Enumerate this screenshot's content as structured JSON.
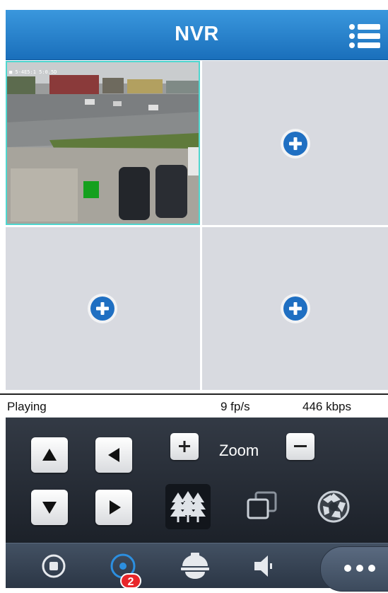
{
  "header": {
    "title": "NVR",
    "menu_icon": "list-menu-icon"
  },
  "video": {
    "osd_text": "■ 5-4E5:1 5:0.5D",
    "channels": [
      {
        "state": "live",
        "selected": true
      },
      {
        "state": "empty",
        "add_icon": "plus-circle-icon"
      },
      {
        "state": "empty",
        "add_icon": "plus-circle-icon"
      },
      {
        "state": "empty",
        "add_icon": "plus-circle-icon"
      }
    ]
  },
  "status": {
    "state": "Playing",
    "fps": "9 fp/s",
    "bitrate": "446 kbps"
  },
  "ptz": {
    "zoom_label": "Zoom",
    "zoom_in_icon": "plus-icon",
    "zoom_out_icon": "minus-icon",
    "buttons": [
      "up-arrow-icon",
      "left-arrow-icon",
      "down-arrow-icon",
      "right-arrow-icon"
    ],
    "tools": [
      "defog-trees-icon",
      "multi-window-icon",
      "aperture-icon"
    ]
  },
  "tabbar": {
    "items": [
      "record-stop-icon",
      "capture-icon",
      "dome-camera-icon",
      "speaker-icon",
      "more-icon"
    ],
    "capture_badge": "2"
  },
  "colors": {
    "header": "#2a84cf",
    "selected_border": "#4fd6cf",
    "badge": "#e8262a",
    "panel": "#252b34"
  }
}
